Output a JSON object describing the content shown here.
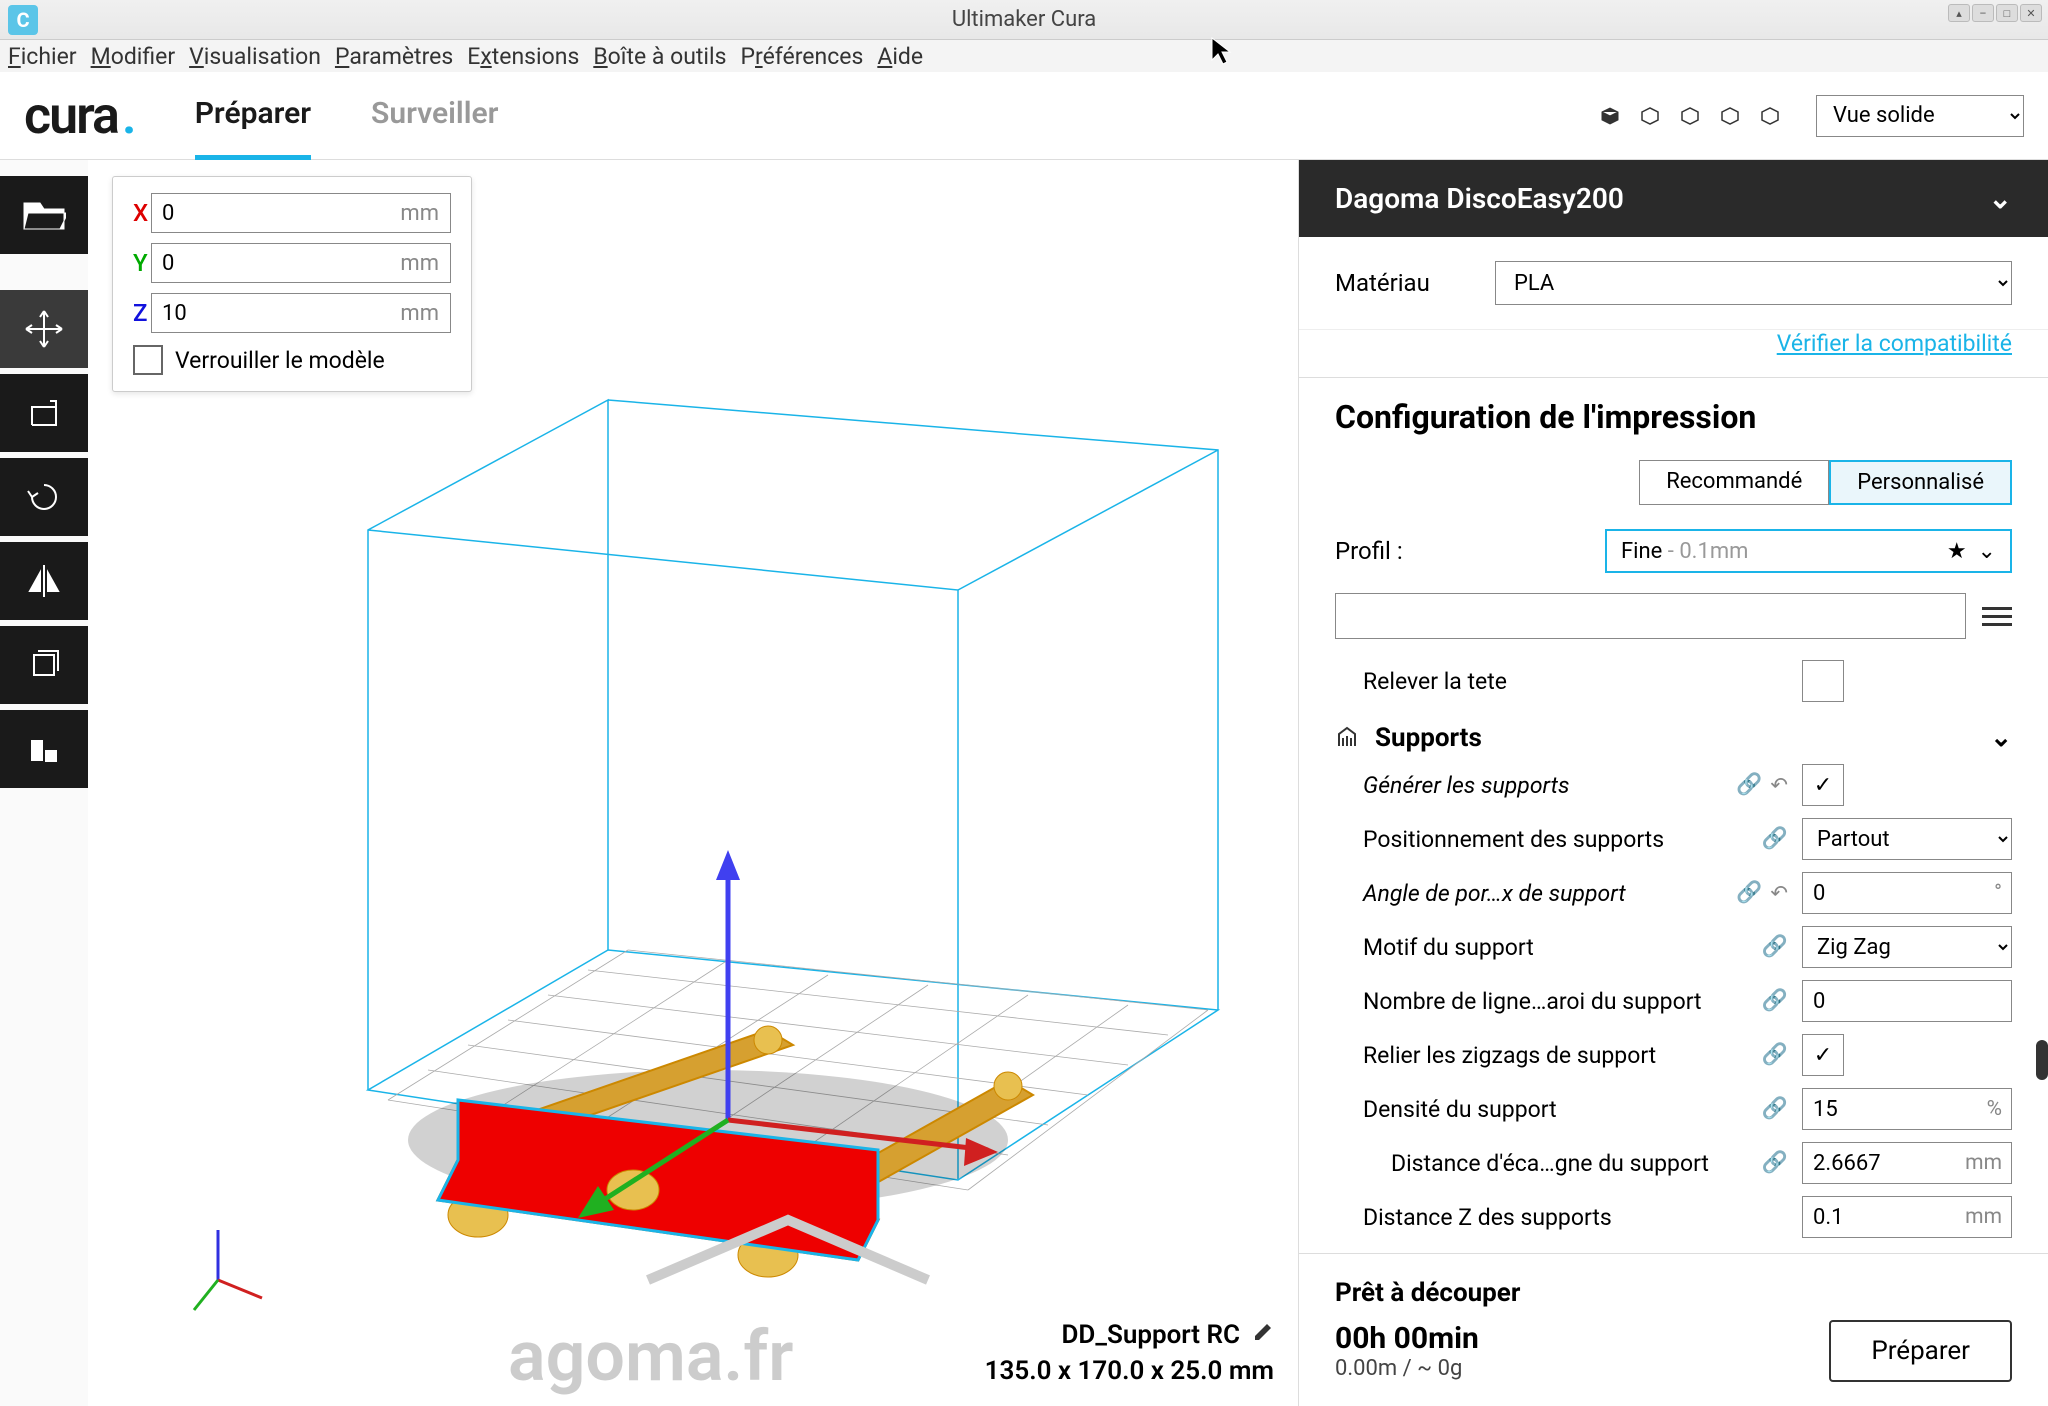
{
  "window": {
    "title": "Ultimaker Cura",
    "icon_letter": "C"
  },
  "menu": {
    "fichier": "Fichier",
    "modifier": "Modifier",
    "visualisation": "Visualisation",
    "parametres": "Paramètres",
    "extensions": "Extensions",
    "boite": "Boîte à outils",
    "preferences": "Préférences",
    "aide": "Aide"
  },
  "logo": "cura",
  "tabs": {
    "preparer": "Préparer",
    "surveiller": "Surveiller"
  },
  "view_mode": "Vue solide",
  "transform": {
    "x": "0",
    "y": "0",
    "z": "10",
    "unit": "mm",
    "lock_label": "Verrouiller le modèle"
  },
  "model": {
    "name": "DD_Support RC",
    "dims": "135.0 x 170.0 x 25.0 mm"
  },
  "printer": {
    "name": "Dagoma DiscoEasy200"
  },
  "material": {
    "label": "Matériau",
    "value": "PLA"
  },
  "compat_link": "Vérifier la compatibilité",
  "config": {
    "title": "Configuration de l'impression",
    "tab_recommended": "Recommandé",
    "tab_custom": "Personnalisé",
    "profil_label": "Profil  :",
    "profil_value": "Fine",
    "profil_sub": " - 0.1mm"
  },
  "settings": {
    "relever": "Relever la tete",
    "supports_header": "Supports",
    "generate": "Générer les supports",
    "placement_label": "Positionnement des supports",
    "placement_value": "Partout",
    "angle_label": "Angle de por…x de support",
    "angle_value": "0",
    "pattern_label": "Motif du support",
    "pattern_value": "Zig Zag",
    "wall_lines_label": "Nombre de ligne…aroi du support",
    "wall_lines_value": "0",
    "connect_zz_label": "Relier les zigzags de support",
    "density_label": "Densité du support",
    "density_value": "15",
    "line_dist_label": "Distance d'éca…gne du support",
    "line_dist_value": "2.6667",
    "z_dist_label": "Distance Z des supports",
    "z_dist_value": "0.1",
    "unit_deg": "°",
    "unit_pct": "%",
    "unit_mm": "mm"
  },
  "bottom": {
    "ready": "Prêt à découper",
    "time": "00h 00min",
    "usage": "0.00m / ~ 0g",
    "prepare_btn": "Préparer"
  }
}
